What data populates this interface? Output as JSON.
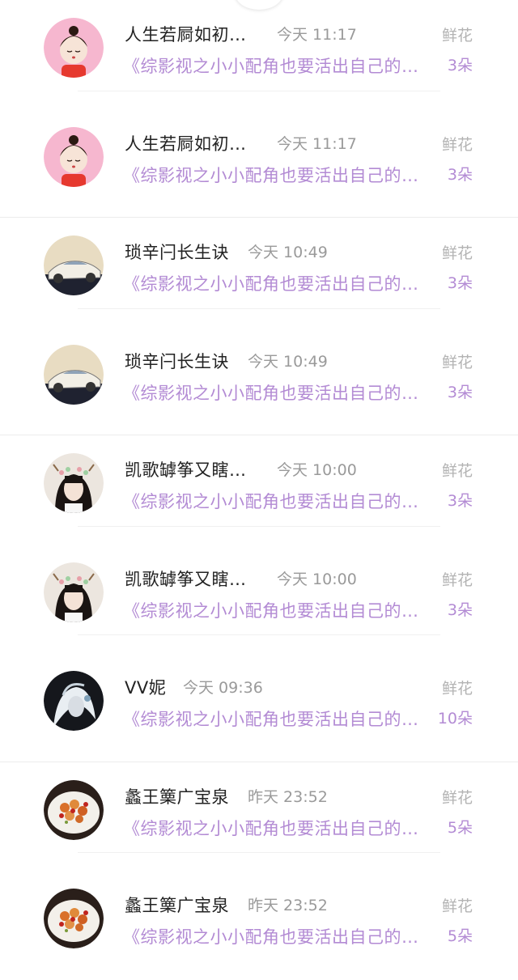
{
  "records": [
    {
      "avatar": "pink-cartoon-girl-avatar",
      "username": "人生若屙如初…",
      "time": "今天 11:17",
      "gift_label": "鲜花",
      "message": "《综影视之小小配角也要活出自己的精彩》",
      "gift_count": "3朵"
    },
    {
      "avatar": "pink-cartoon-girl-avatar",
      "username": "人生若屙如初…",
      "time": "今天 11:17",
      "gift_label": "鲜花",
      "message": "《综影视之小小配角也要活出自己的精彩》",
      "gift_count": "3朵"
    },
    {
      "avatar": "sports-car-avatar",
      "username": "琐辛闩长生诀",
      "time": "今天 10:49",
      "gift_label": "鲜花",
      "message": "《综影视之小小配角也要活出自己的精彩》",
      "gift_count": "3朵"
    },
    {
      "avatar": "sports-car-avatar",
      "username": "琐辛闩长生诀",
      "time": "今天 10:49",
      "gift_label": "鲜花",
      "message": "《综影视之小小配角也要活出自己的精彩》",
      "gift_count": "3朵"
    },
    {
      "avatar": "girl-flower-crown-avatar",
      "username": "凯歌罅筝又瞎…",
      "time": "今天 10:00",
      "gift_label": "鲜花",
      "message": "《综影视之小小配角也要活出自己的精彩》",
      "gift_count": "3朵"
    },
    {
      "avatar": "girl-flower-crown-avatar",
      "username": "凯歌罅筝又瞎…",
      "time": "今天 10:00",
      "gift_label": "鲜花",
      "message": "《综影视之小小配角也要活出自己的精彩》",
      "gift_count": "3朵"
    },
    {
      "avatar": "white-hair-character-avatar",
      "username": "VV妮",
      "time": "今天 09:36",
      "gift_label": "鲜花",
      "message": "《综影视之小小配角也要活出自己的精彩》",
      "gift_count": "10朵"
    },
    {
      "avatar": "food-dish-avatar",
      "username": "蠡王篥广宝泉",
      "time": "昨天 23:52",
      "gift_label": "鲜花",
      "message": "《综影视之小小配角也要活出自己的精彩》",
      "gift_count": "5朵"
    },
    {
      "avatar": "food-dish-avatar",
      "username": "蠡王篥广宝泉",
      "time": "昨天 23:52",
      "gift_label": "鲜花",
      "message": "《综影视之小小配角也要活出自己的精彩》",
      "gift_count": "5朵"
    }
  ],
  "colors": {
    "accent_purple": "#b38bd4",
    "name_text": "#222222",
    "time_text": "#9a9a9a",
    "gift_label_text": "#b3b3b3"
  }
}
